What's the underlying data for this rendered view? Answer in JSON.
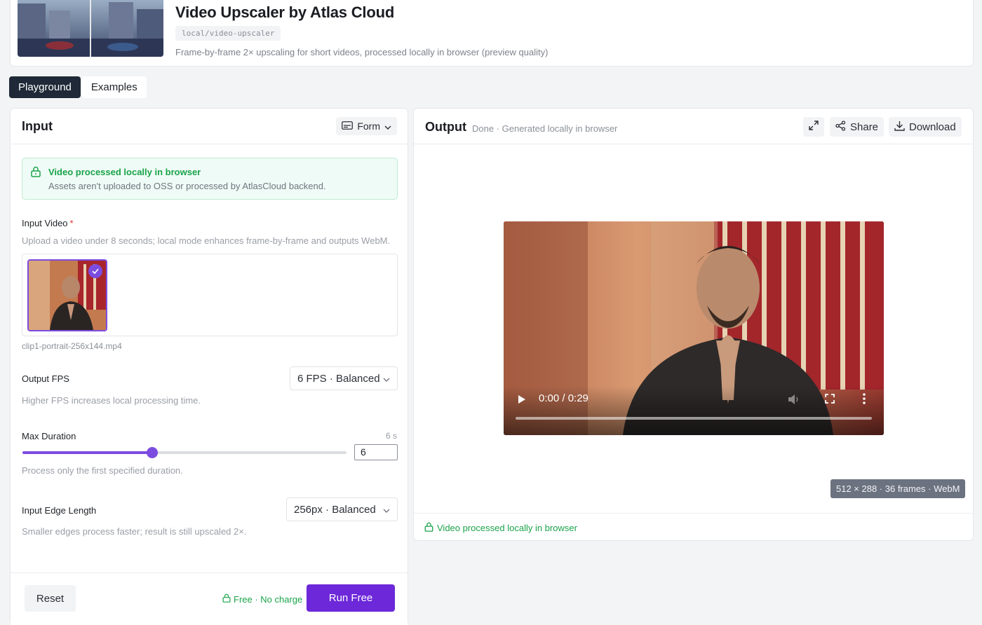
{
  "header": {
    "title": "Video Upscaler by Atlas Cloud",
    "slug": "local/video-upscaler",
    "description": "Frame-by-frame 2× upscaling for short videos, processed locally in browser (preview quality)"
  },
  "tabs": [
    {
      "label": "Playground",
      "active": true
    },
    {
      "label": "Examples",
      "active": false
    }
  ],
  "input": {
    "title": "Input",
    "mode_button": "Form",
    "notice": {
      "title": "Video processed locally in browser",
      "text": "Assets aren't uploaded to OSS or processed by AtlasCloud backend."
    },
    "video_field": {
      "label": "Input Video",
      "required_mark": "*",
      "hint": "Upload a video under 8 seconds; local mode enhances frame-by-frame and outputs WebM.",
      "filename": "clip1-portrait-256x144.mp4"
    },
    "fps_field": {
      "label": "Output FPS",
      "value": "6 FPS · Balanced",
      "hint": "Higher FPS increases local processing time."
    },
    "duration_field": {
      "label": "Max Duration",
      "value_display": "6 s",
      "input_value": "6",
      "slider_fraction": 0.4,
      "hint": "Process only the first specified duration."
    },
    "edge_field": {
      "label": "Input Edge Length",
      "value": "256px · Balanced",
      "hint": "Smaller edges process faster; result is still upscaled 2×."
    },
    "footer": {
      "reset_label": "Reset",
      "free_note": "Free · No charge",
      "run_label": "Run Free"
    }
  },
  "output": {
    "title": "Output",
    "status": "Done · Generated locally in browser",
    "share_label": "Share",
    "download_label": "Download",
    "video_time": "0:00 / 0:29",
    "meta": "512 × 288 · 36 frames · WebM",
    "footer_note": "Video processed locally in browser"
  },
  "colors": {
    "accent": "#6d28d9",
    "success": "#1aa34a"
  }
}
